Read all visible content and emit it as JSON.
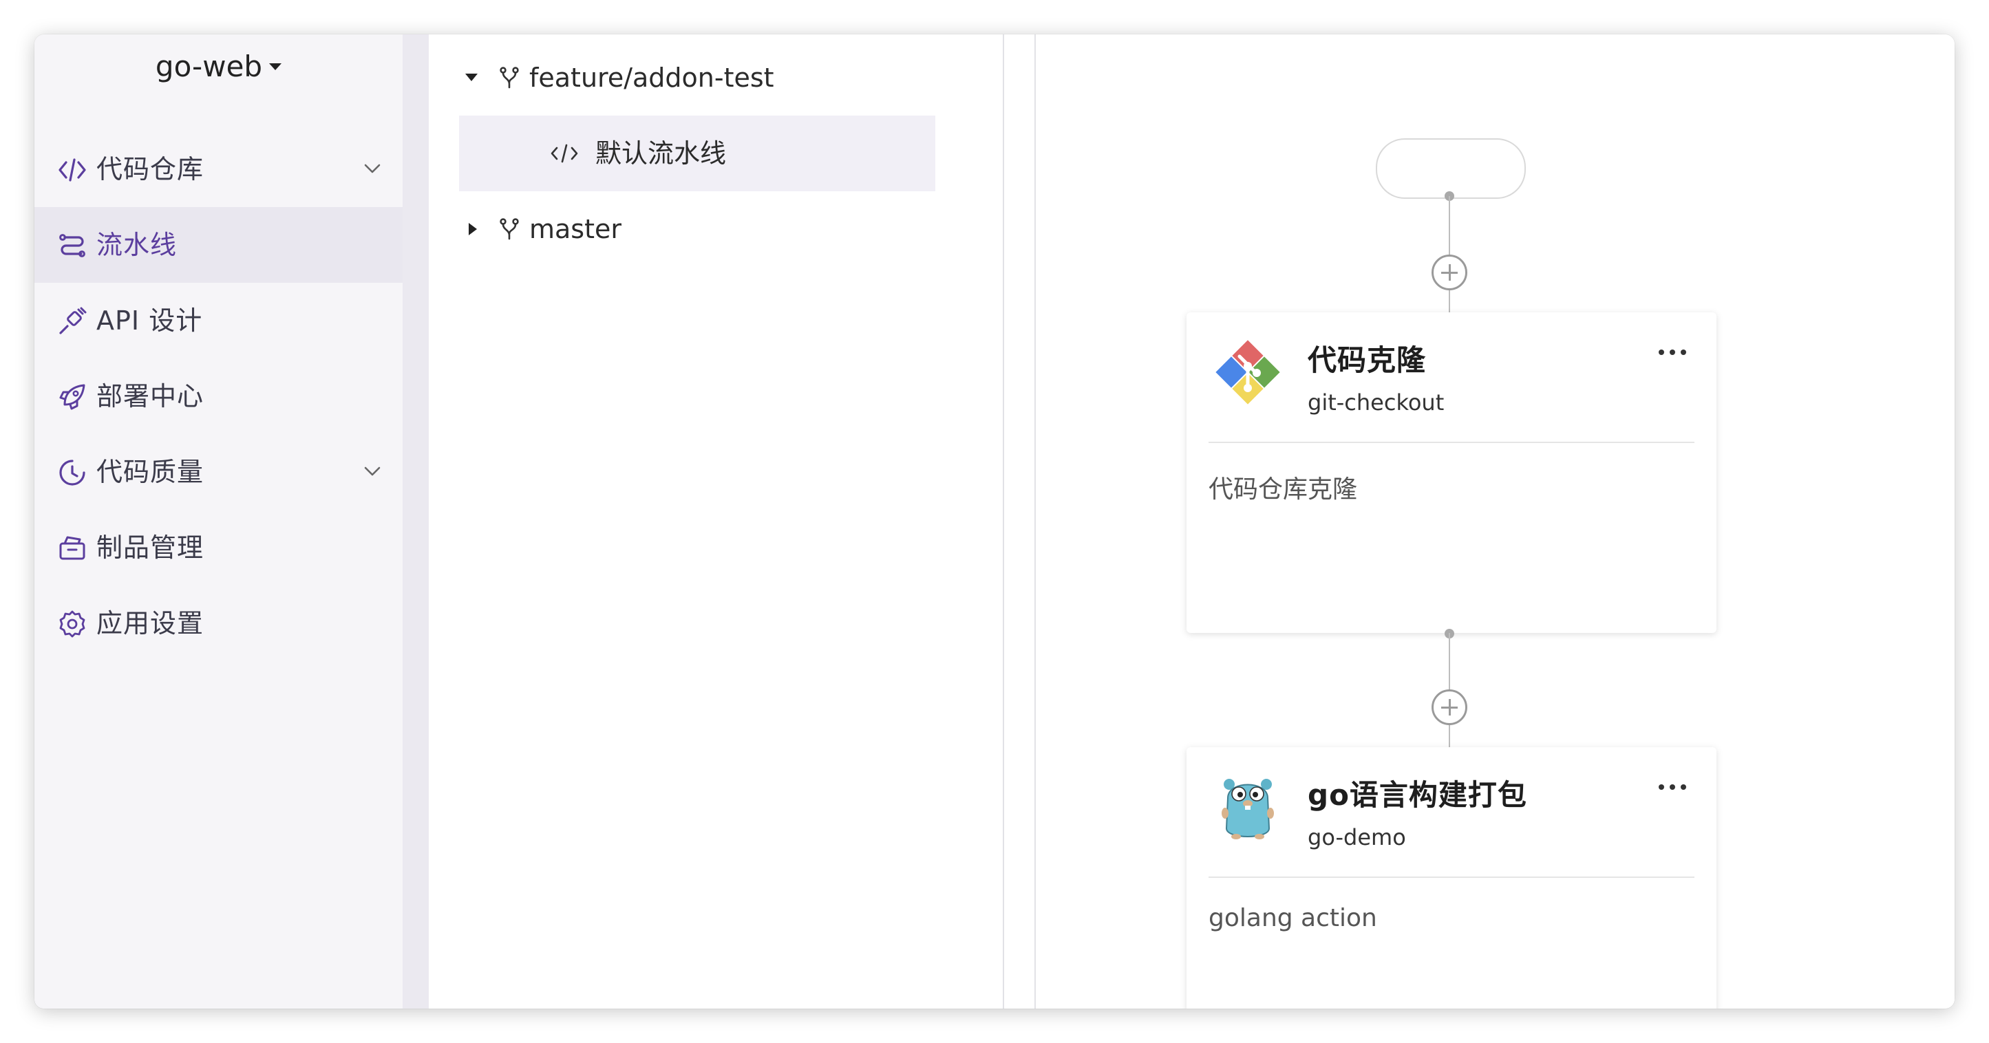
{
  "app": {
    "name": "go-web"
  },
  "sidebar": {
    "items": [
      {
        "label": "代码仓库",
        "icon": "code-icon",
        "expandable": true,
        "active": false
      },
      {
        "label": "流水线",
        "icon": "pipeline-icon",
        "expandable": false,
        "active": true
      },
      {
        "label": "API 设计",
        "icon": "api-plug-icon",
        "expandable": false,
        "active": false
      },
      {
        "label": "部署中心",
        "icon": "rocket-icon",
        "expandable": false,
        "active": false
      },
      {
        "label": "代码质量",
        "icon": "quality-gauge-icon",
        "expandable": true,
        "active": false
      },
      {
        "label": "制品管理",
        "icon": "artifact-box-icon",
        "expandable": false,
        "active": false
      },
      {
        "label": "应用设置",
        "icon": "gear-icon",
        "expandable": false,
        "active": false
      }
    ],
    "accent_color": "#5b3e9e"
  },
  "branches": [
    {
      "name": "feature/addon-test",
      "expanded": true,
      "pipelines": [
        {
          "name": "默认流水线",
          "selected": true
        }
      ]
    },
    {
      "name": "master",
      "expanded": false,
      "pipelines": []
    }
  ],
  "pipeline": {
    "nodes": [
      {
        "title": "代码克隆",
        "subtitle": "git-checkout",
        "description": "代码仓库克隆",
        "logo": "git-logo-icon"
      },
      {
        "title": "go语言构建打包",
        "subtitle": "go-demo",
        "description": "golang action",
        "logo": "gopher-logo-icon"
      }
    ]
  }
}
